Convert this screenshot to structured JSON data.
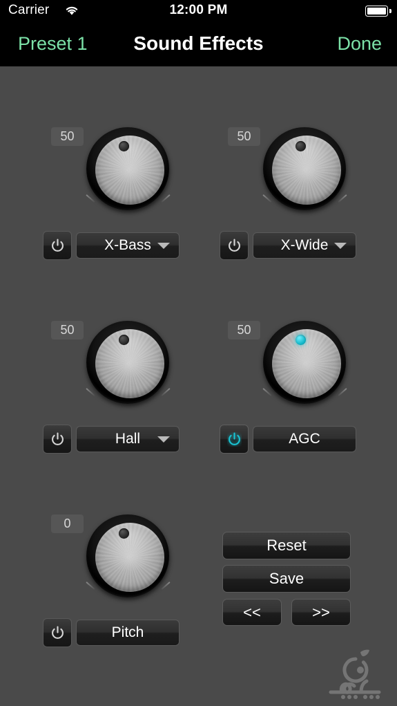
{
  "status_bar": {
    "carrier": "Carrier",
    "wifi_icon": "wifi-icon",
    "time": "12:00 PM",
    "battery_icon": "battery-full-icon"
  },
  "nav_bar": {
    "left_button": "Preset 1",
    "title": "Sound Effects",
    "right_button": "Done",
    "accent_color": "#7ce2a8",
    "background_color": "#000000"
  },
  "theme": {
    "background": "#4a4a4a",
    "active_color": "#1ac4d4",
    "field_text": "#ffffff",
    "badge_text": "#d8d8d8"
  },
  "effects": [
    {
      "id": "x-bass",
      "value": "50",
      "label": "X-Bass",
      "power_on": false,
      "has_dropdown": true,
      "power_icon": "power-icon"
    },
    {
      "id": "x-wide",
      "value": "50",
      "label": "X-Wide",
      "power_on": false,
      "has_dropdown": true,
      "power_icon": "power-icon"
    },
    {
      "id": "hall",
      "value": "50",
      "label": "Hall",
      "power_on": false,
      "has_dropdown": true,
      "power_icon": "power-icon"
    },
    {
      "id": "agc",
      "value": "50",
      "label": "AGC",
      "power_on": true,
      "has_dropdown": false,
      "power_icon": "power-icon"
    },
    {
      "id": "pitch",
      "value": "0",
      "label": "Pitch",
      "power_on": false,
      "has_dropdown": false,
      "power_icon": "power-icon"
    }
  ],
  "actions": {
    "reset": "Reset",
    "save": "Save",
    "prev": "<<",
    "next": ">>"
  },
  "watermark": {
    "name": "sibapp-logo-watermark"
  }
}
